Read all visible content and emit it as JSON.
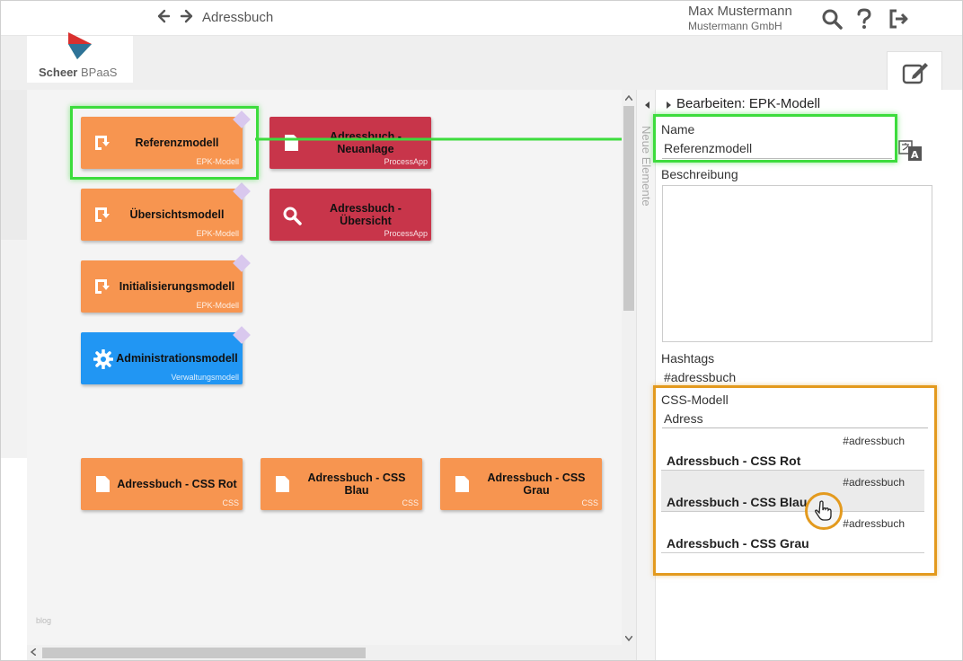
{
  "header": {
    "title": "Adressbuch",
    "user_name": "Max Mustermann",
    "user_company": "Mustermann GmbH"
  },
  "logo": {
    "brand": "Scheer",
    "product": "BPaaS"
  },
  "canvas": {
    "models": [
      {
        "label": "Referenzmodell",
        "type": "EPK-Modell"
      },
      {
        "label": "Übersichtsmodell",
        "type": "EPK-Modell"
      },
      {
        "label": "Initialisierungsmodell",
        "type": "EPK-Modell"
      },
      {
        "label": "Administrationsmodell",
        "type": "Verwaltungsmodell"
      }
    ],
    "apps": [
      {
        "label": "Adressbuch - Neuanlage",
        "type": "ProcessApp"
      },
      {
        "label": "Adressbuch - Übersicht",
        "type": "ProcessApp"
      }
    ],
    "css": [
      {
        "label": "Adressbuch - CSS Rot",
        "type": "CSS"
      },
      {
        "label": "Adressbuch - CSS Blau",
        "type": "CSS"
      },
      {
        "label": "Adressbuch - CSS Grau",
        "type": "CSS"
      }
    ],
    "blog_label": "blog"
  },
  "sidetab": {
    "label": "Neue Elemente"
  },
  "panel": {
    "title": "Bearbeiten: EPK-Modell",
    "name_label": "Name",
    "name_value": "Referenzmodell",
    "description_label": "Beschreibung",
    "hashtags_label": "Hashtags",
    "hashtags_value": "#adressbuch",
    "css_label": "CSS-Modell",
    "css_input": "Adress",
    "options": [
      {
        "tag": "#adressbuch",
        "name": "Adressbuch - CSS Rot"
      },
      {
        "tag": "#adressbuch",
        "name": "Adressbuch - CSS Blau"
      },
      {
        "tag": "#adressbuch",
        "name": "Adressbuch - CSS Grau"
      }
    ]
  },
  "colors": {
    "model_orange": "#f79550",
    "app_red": "#c8354a",
    "admin_blue": "#2196f3",
    "highlight_green": "#3ddc3d",
    "highlight_orange": "#e39a1e"
  },
  "icons": [
    "back-arrow-icon",
    "forward-arrow-icon",
    "search-icon",
    "help-icon",
    "logout-icon",
    "edit-icon",
    "translate-icon",
    "epk-model-icon",
    "document-icon",
    "gear-icon",
    "pointer-hand-icon"
  ]
}
